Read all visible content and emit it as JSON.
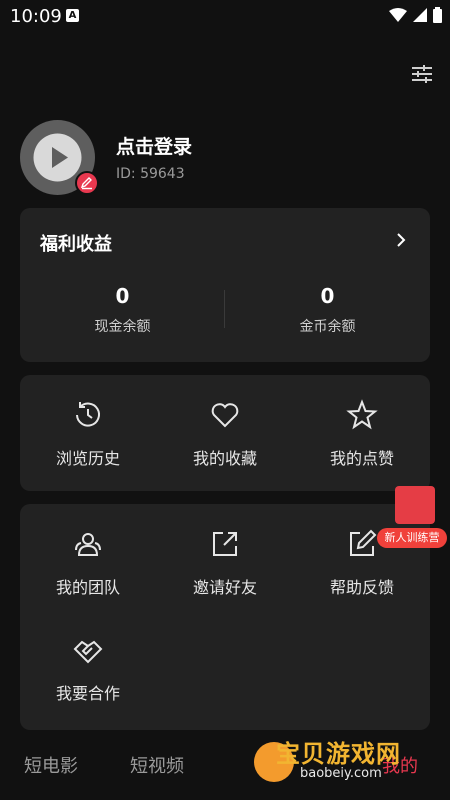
{
  "status_bar": {
    "time": "10:09",
    "notification_badge": "A"
  },
  "profile": {
    "login_label": "点击登录",
    "id_text": "ID: 59643"
  },
  "welfare": {
    "title": "福利收益",
    "cash_value": "0",
    "cash_label": "现金余额",
    "coin_value": "0",
    "coin_label": "金币余额"
  },
  "quick_actions": [
    {
      "label": "浏览历史",
      "icon": "history-icon"
    },
    {
      "label": "我的收藏",
      "icon": "heart-icon"
    },
    {
      "label": "我的点赞",
      "icon": "star-icon"
    }
  ],
  "more_actions": [
    {
      "label": "我的团队",
      "icon": "team-icon"
    },
    {
      "label": "邀请好友",
      "icon": "share-icon"
    },
    {
      "label": "帮助反馈",
      "icon": "edit-icon"
    },
    {
      "label": "我要合作",
      "icon": "handshake-icon"
    }
  ],
  "promo_badge": {
    "label": "新人训练营"
  },
  "bottom_nav": {
    "tabs": [
      "短电影",
      "短视频"
    ],
    "partial_tab": "我的"
  },
  "watermark": {
    "brand": "宝贝游戏网",
    "site": "baobeiy.com"
  },
  "colors": {
    "background": "#111111",
    "card": "#222222",
    "accent": "#e8384f"
  }
}
